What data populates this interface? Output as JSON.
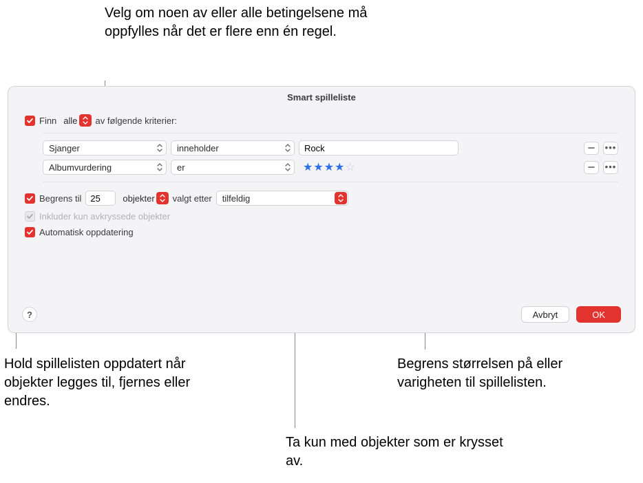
{
  "callouts": {
    "top": "Velg om noen av eller alle betingelsene må oppfylles når det er flere enn én regel.",
    "bottom_left": "Hold spillelisten oppdatert når objekter legges til, fjernes eller endres.",
    "bottom_mid": "Ta kun med objekter som er krysset av.",
    "bottom_right": "Begrens størrelsen på eller varigheten til spillelisten."
  },
  "dialog": {
    "title": "Smart spilleliste",
    "match_label": "Finn",
    "match_mode": "alle",
    "match_suffix": "av følgende kriterier:",
    "rules": [
      {
        "field": "Sjanger",
        "operator": "inneholder",
        "value_text": "Rock",
        "kind": "text"
      },
      {
        "field": "Albumvurdering",
        "operator": "er",
        "stars": 4,
        "max_stars": 5,
        "kind": "stars"
      }
    ],
    "limit": {
      "label": "Begrens til",
      "value": "25",
      "unit": "objekter",
      "selected_by_label": "valgt etter",
      "selected_by": "tilfeldig"
    },
    "only_checked_label": "Inkluder kun avkryssede objekter",
    "live_update_label": "Automatisk oppdatering",
    "buttons": {
      "cancel": "Avbryt",
      "ok": "OK"
    }
  }
}
